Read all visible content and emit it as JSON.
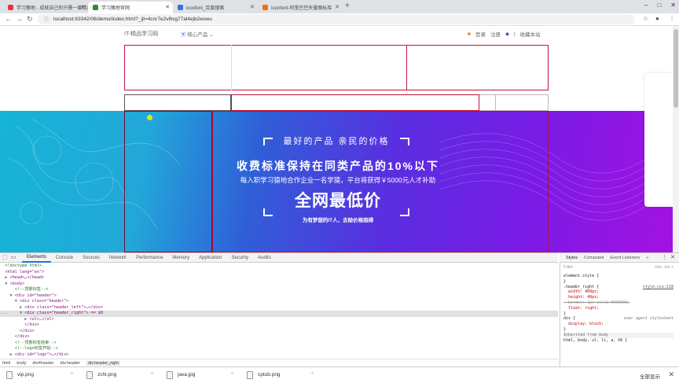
{
  "browser": {
    "tabs": [
      {
        "title": "学习猿地 - 成就自己的只需一套精品",
        "active": false,
        "favicon_color": "#e8333b"
      },
      {
        "title": "学习猿地官网",
        "active": true,
        "favicon_color": "#2b8a3e"
      },
      {
        "title": "iconfont_百度搜索",
        "active": false,
        "favicon_color": "#3a6fe0"
      },
      {
        "title": "Iconfont-阿里巴巴矢量图标库",
        "active": false,
        "favicon_color": "#ff6a00"
      }
    ],
    "new_tab": "+",
    "url": "localhost:63342/06/demo/index.html?_ijt=4cnr7e2vlltvg77al4ejb2eowu"
  },
  "site": {
    "logo": "IT-精品学习网",
    "core_products": "核心产品",
    "login": "登录",
    "register": "注册",
    "separator": "|",
    "bookmark": "收藏本站"
  },
  "banner": {
    "line1": "最好的产品  亲民的价格",
    "line2": "收费标准保持在同类产品的10%以下",
    "line3": "每入职学习猿地合作企业一名学猿，平台将获得￥5000元人才补助",
    "line4": "全网最低价",
    "line5": "为有梦想的IT人，去除价格阻碍"
  },
  "devtools": {
    "tabs": [
      "Elements",
      "Console",
      "Sources",
      "Network",
      "Performance",
      "Memory",
      "Application",
      "Security",
      "Audits"
    ],
    "active_tab": "Elements",
    "dom_lines": [
      {
        "indent": "  ",
        "text": "<!doctype html>",
        "kind": "cm"
      },
      {
        "indent": "  ",
        "text": "<html lang=\"en\">",
        "kind": "tg"
      },
      {
        "indent": "  ▶ ",
        "text": "<head>…</head>",
        "kind": "tg"
      },
      {
        "indent": "  ▼ ",
        "text": "<body>",
        "kind": "tg"
      },
      {
        "indent": "      ",
        "text": "<!--顶部标签-->",
        "kind": "cm"
      },
      {
        "indent": "    ▼ ",
        "text": "<div id=\"header\">",
        "kind": "tg"
      },
      {
        "indent": "      ▼ ",
        "text": "<div class=\"header\">",
        "kind": "tg"
      },
      {
        "indent": "        ▶ ",
        "text": "<div class=\"header_left\">…</div>",
        "kind": "tg"
      },
      {
        "indent": "...     ▼ ",
        "text": "<div class=\"header_right\"> == $0",
        "kind": "tg",
        "selected": true
      },
      {
        "indent": "          ▶ ",
        "text": "<ul>…</ul>",
        "kind": "tg"
      },
      {
        "indent": "          ",
        "text": "</div>",
        "kind": "tg"
      },
      {
        "indent": "        ",
        "text": "</div>",
        "kind": "tg"
      },
      {
        "indent": "      ",
        "text": "</div>",
        "kind": "tg"
      },
      {
        "indent": "      ",
        "text": "<!--顶部标签结束-->",
        "kind": "cm"
      },
      {
        "indent": "      ",
        "text": "<!--logo标签开始-->",
        "kind": "cm"
      },
      {
        "indent": "    ▶ ",
        "text": "<div id=\"logo\">…</div>",
        "kind": "tg"
      }
    ],
    "breadcrumbs": [
      "html",
      "body",
      "div#header",
      "div.header",
      "div.header_right"
    ],
    "styles_tabs": [
      "Styles",
      "Computed",
      "Event Listeners",
      "»"
    ],
    "filter_placeholder": "Filter",
    "filter_buttons": ":hov  .cls  +",
    "style_lines": [
      "element.style {",
      "}",
      ".header_right {",
      "  width: 400px;",
      "  height: 40px;",
      "  border: 1px solid #000000;",
      "  float: right;",
      "}",
      "div {",
      "  display: block;",
      "}",
      "Inherited from body",
      "html, body, ul, li, a, h6 {"
    ],
    "style_source": "style.css:118",
    "ua_source": "user agent stylesheet"
  },
  "downloads": {
    "files": [
      "vip.png",
      "zchl.png",
      "java.jpg",
      "cptub.png"
    ],
    "show_all": "全部显示",
    "close": "✕"
  }
}
